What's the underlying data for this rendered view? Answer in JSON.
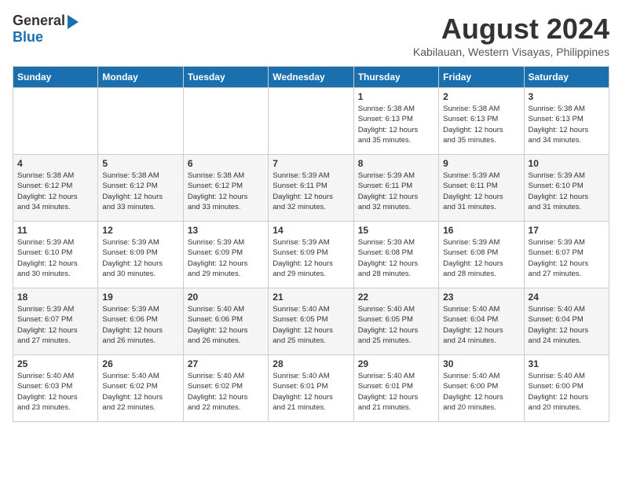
{
  "logo": {
    "general": "General",
    "blue": "Blue"
  },
  "title": "August 2024",
  "subtitle": "Kabilauan, Western Visayas, Philippines",
  "weekdays": [
    "Sunday",
    "Monday",
    "Tuesday",
    "Wednesday",
    "Thursday",
    "Friday",
    "Saturday"
  ],
  "weeks": [
    [
      {
        "day": "",
        "info": ""
      },
      {
        "day": "",
        "info": ""
      },
      {
        "day": "",
        "info": ""
      },
      {
        "day": "",
        "info": ""
      },
      {
        "day": "1",
        "info": "Sunrise: 5:38 AM\nSunset: 6:13 PM\nDaylight: 12 hours\nand 35 minutes."
      },
      {
        "day": "2",
        "info": "Sunrise: 5:38 AM\nSunset: 6:13 PM\nDaylight: 12 hours\nand 35 minutes."
      },
      {
        "day": "3",
        "info": "Sunrise: 5:38 AM\nSunset: 6:13 PM\nDaylight: 12 hours\nand 34 minutes."
      }
    ],
    [
      {
        "day": "4",
        "info": "Sunrise: 5:38 AM\nSunset: 6:12 PM\nDaylight: 12 hours\nand 34 minutes."
      },
      {
        "day": "5",
        "info": "Sunrise: 5:38 AM\nSunset: 6:12 PM\nDaylight: 12 hours\nand 33 minutes."
      },
      {
        "day": "6",
        "info": "Sunrise: 5:38 AM\nSunset: 6:12 PM\nDaylight: 12 hours\nand 33 minutes."
      },
      {
        "day": "7",
        "info": "Sunrise: 5:39 AM\nSunset: 6:11 PM\nDaylight: 12 hours\nand 32 minutes."
      },
      {
        "day": "8",
        "info": "Sunrise: 5:39 AM\nSunset: 6:11 PM\nDaylight: 12 hours\nand 32 minutes."
      },
      {
        "day": "9",
        "info": "Sunrise: 5:39 AM\nSunset: 6:11 PM\nDaylight: 12 hours\nand 31 minutes."
      },
      {
        "day": "10",
        "info": "Sunrise: 5:39 AM\nSunset: 6:10 PM\nDaylight: 12 hours\nand 31 minutes."
      }
    ],
    [
      {
        "day": "11",
        "info": "Sunrise: 5:39 AM\nSunset: 6:10 PM\nDaylight: 12 hours\nand 30 minutes."
      },
      {
        "day": "12",
        "info": "Sunrise: 5:39 AM\nSunset: 6:09 PM\nDaylight: 12 hours\nand 30 minutes."
      },
      {
        "day": "13",
        "info": "Sunrise: 5:39 AM\nSunset: 6:09 PM\nDaylight: 12 hours\nand 29 minutes."
      },
      {
        "day": "14",
        "info": "Sunrise: 5:39 AM\nSunset: 6:09 PM\nDaylight: 12 hours\nand 29 minutes."
      },
      {
        "day": "15",
        "info": "Sunrise: 5:39 AM\nSunset: 6:08 PM\nDaylight: 12 hours\nand 28 minutes."
      },
      {
        "day": "16",
        "info": "Sunrise: 5:39 AM\nSunset: 6:08 PM\nDaylight: 12 hours\nand 28 minutes."
      },
      {
        "day": "17",
        "info": "Sunrise: 5:39 AM\nSunset: 6:07 PM\nDaylight: 12 hours\nand 27 minutes."
      }
    ],
    [
      {
        "day": "18",
        "info": "Sunrise: 5:39 AM\nSunset: 6:07 PM\nDaylight: 12 hours\nand 27 minutes."
      },
      {
        "day": "19",
        "info": "Sunrise: 5:39 AM\nSunset: 6:06 PM\nDaylight: 12 hours\nand 26 minutes."
      },
      {
        "day": "20",
        "info": "Sunrise: 5:40 AM\nSunset: 6:06 PM\nDaylight: 12 hours\nand 26 minutes."
      },
      {
        "day": "21",
        "info": "Sunrise: 5:40 AM\nSunset: 6:05 PM\nDaylight: 12 hours\nand 25 minutes."
      },
      {
        "day": "22",
        "info": "Sunrise: 5:40 AM\nSunset: 6:05 PM\nDaylight: 12 hours\nand 25 minutes."
      },
      {
        "day": "23",
        "info": "Sunrise: 5:40 AM\nSunset: 6:04 PM\nDaylight: 12 hours\nand 24 minutes."
      },
      {
        "day": "24",
        "info": "Sunrise: 5:40 AM\nSunset: 6:04 PM\nDaylight: 12 hours\nand 24 minutes."
      }
    ],
    [
      {
        "day": "25",
        "info": "Sunrise: 5:40 AM\nSunset: 6:03 PM\nDaylight: 12 hours\nand 23 minutes."
      },
      {
        "day": "26",
        "info": "Sunrise: 5:40 AM\nSunset: 6:02 PM\nDaylight: 12 hours\nand 22 minutes."
      },
      {
        "day": "27",
        "info": "Sunrise: 5:40 AM\nSunset: 6:02 PM\nDaylight: 12 hours\nand 22 minutes."
      },
      {
        "day": "28",
        "info": "Sunrise: 5:40 AM\nSunset: 6:01 PM\nDaylight: 12 hours\nand 21 minutes."
      },
      {
        "day": "29",
        "info": "Sunrise: 5:40 AM\nSunset: 6:01 PM\nDaylight: 12 hours\nand 21 minutes."
      },
      {
        "day": "30",
        "info": "Sunrise: 5:40 AM\nSunset: 6:00 PM\nDaylight: 12 hours\nand 20 minutes."
      },
      {
        "day": "31",
        "info": "Sunrise: 5:40 AM\nSunset: 6:00 PM\nDaylight: 12 hours\nand 20 minutes."
      }
    ]
  ]
}
